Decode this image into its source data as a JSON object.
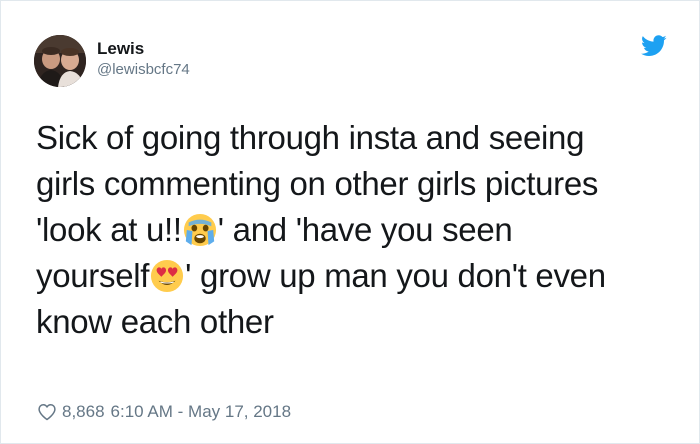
{
  "author": {
    "display_name": "Lewis",
    "handle": "@lewisbcfc74",
    "avatar_icon": "profile-photo"
  },
  "brand": {
    "icon": "twitter-bird-icon",
    "color": "#1da1f2"
  },
  "tweet": {
    "lines": [
      "Sick of going through insta and seeing",
      "girls commenting on other girls pictures"
    ],
    "line3_pre": "'look at u!!",
    "line3_emoji": "crying-face-emoji",
    "line3_post": "' and 'have you seen",
    "line4_pre": "yourself",
    "line4_emoji": "heart-eyes-emoji",
    "line4_post": "' grow up man you don't even",
    "line5": "know each other"
  },
  "meta": {
    "likes": "8,868",
    "timestamp": "6:10 AM - May 17, 2018"
  },
  "colors": {
    "text": "#14171a",
    "secondary": "#657786",
    "border": "#e1e8ed"
  }
}
